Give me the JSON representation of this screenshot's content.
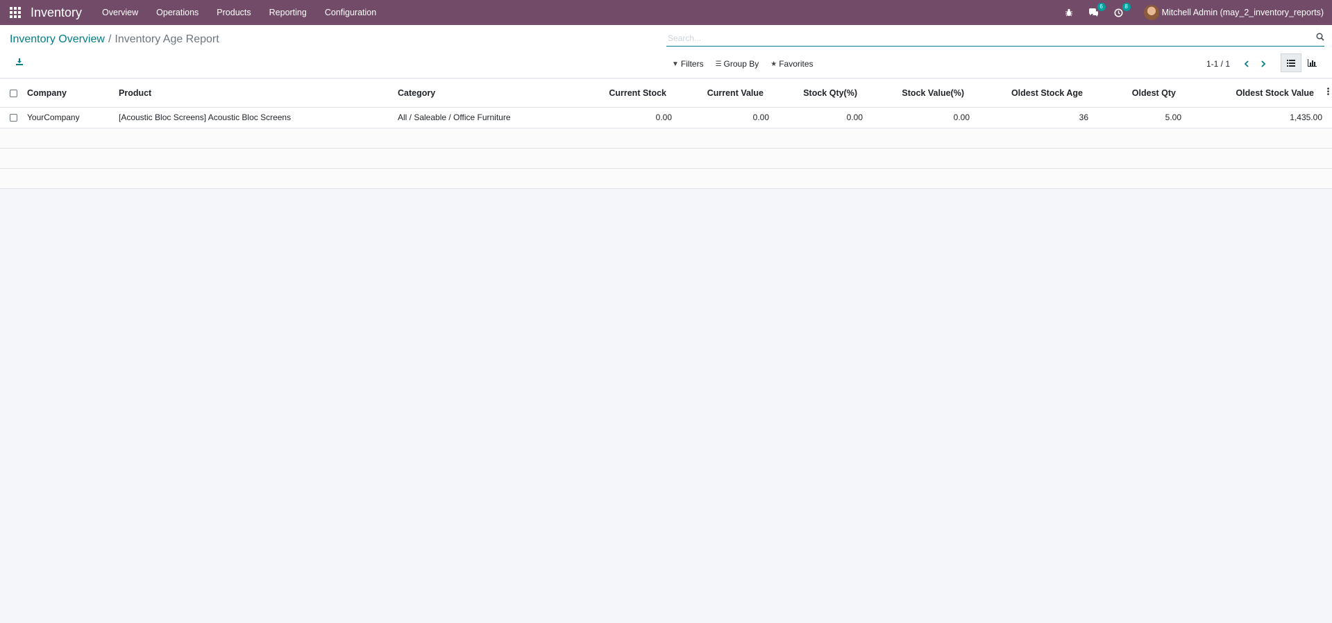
{
  "navbar": {
    "app_name": "Inventory",
    "menu": [
      "Overview",
      "Operations",
      "Products",
      "Reporting",
      "Configuration"
    ],
    "messages_count": "6",
    "activities_count": "8",
    "user": "Mitchell Admin (may_2_inventory_reports)",
    "bg_color": "#714b67"
  },
  "breadcrumb": {
    "parent": "Inventory Overview",
    "separator": "/",
    "current": "Inventory Age Report"
  },
  "search": {
    "placeholder": "Search..."
  },
  "filters": {
    "filters_label": "Filters",
    "group_by_label": "Group By",
    "favorites_label": "Favorites"
  },
  "pager": {
    "value": "1-1 / 1"
  },
  "table": {
    "columns": [
      "Company",
      "Product",
      "Category",
      "Current Stock",
      "Current Value",
      "Stock Qty(%)",
      "Stock Value(%)",
      "Oldest Stock Age",
      "Oldest Qty",
      "Oldest Stock Value"
    ],
    "rows": [
      [
        "YourCompany",
        "[Acoustic Bloc Screens] Acoustic Bloc Screens",
        "All / Saleable / Office Furniture",
        "0.00",
        "0.00",
        "0.00",
        "0.00",
        "36",
        "5.00",
        "1,435.00"
      ]
    ]
  },
  "accent_color": "#017e84",
  "badge_color": "#00a09d"
}
